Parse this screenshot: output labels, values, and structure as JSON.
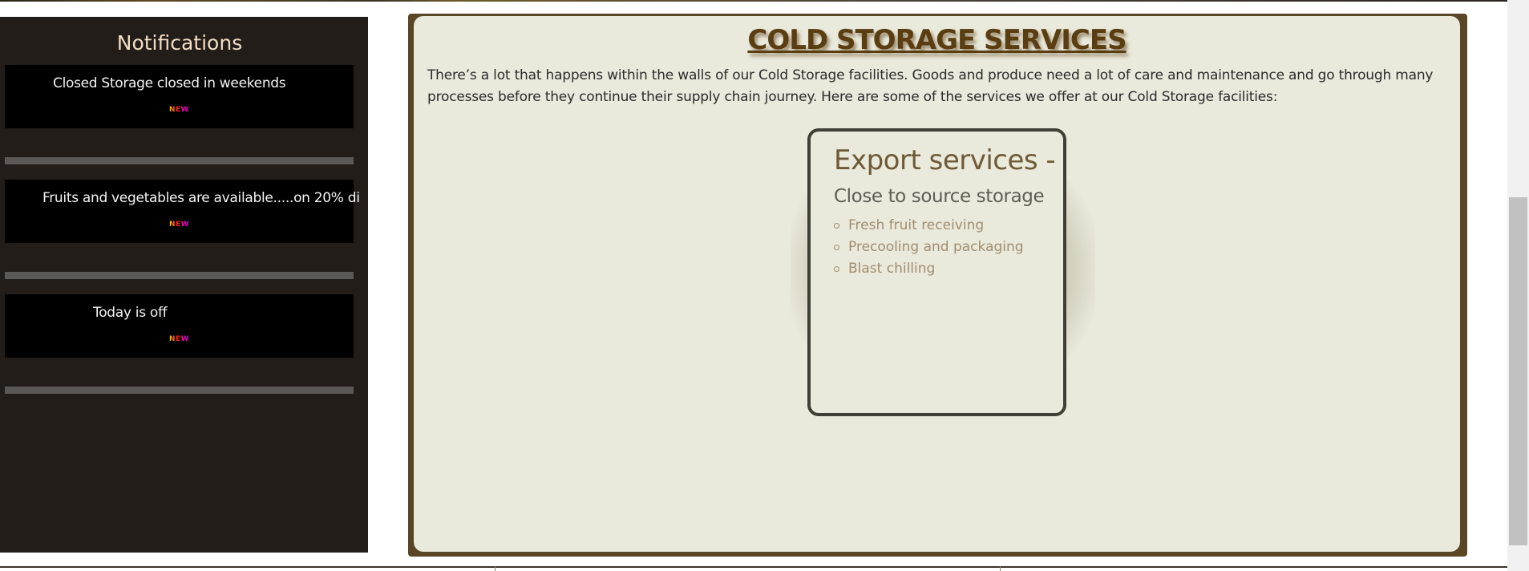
{
  "sidebar": {
    "title": "Notifications",
    "notifications": [
      {
        "text": "Closed Storage closed in weekends",
        "badge": "NEW"
      },
      {
        "text": "Fruits and vegetables are available.....on 20% di",
        "badge": "NEW"
      },
      {
        "text": "Today is off",
        "badge": "NEW"
      }
    ]
  },
  "main": {
    "title": "COLD STORAGE SERVICES",
    "intro": "There’s a lot that happens within the walls of our Cold Storage facilities. Goods and produce need a lot of care and maintenance and go through many processes before they continue their supply chain journey. Here are some of the services we offer at our Cold Storage facilities:",
    "card": {
      "heading": "Export services -",
      "subheading": "Close to source storage",
      "items": [
        "Fresh fruit receiving",
        "Precooling and packaging",
        "Blast chilling"
      ]
    }
  },
  "colors": {
    "sidebar_bg": "#231d1a",
    "panel_border": "#5a4525",
    "panel_bg": "#e9e9dc",
    "title_color": "#5a3e12"
  }
}
